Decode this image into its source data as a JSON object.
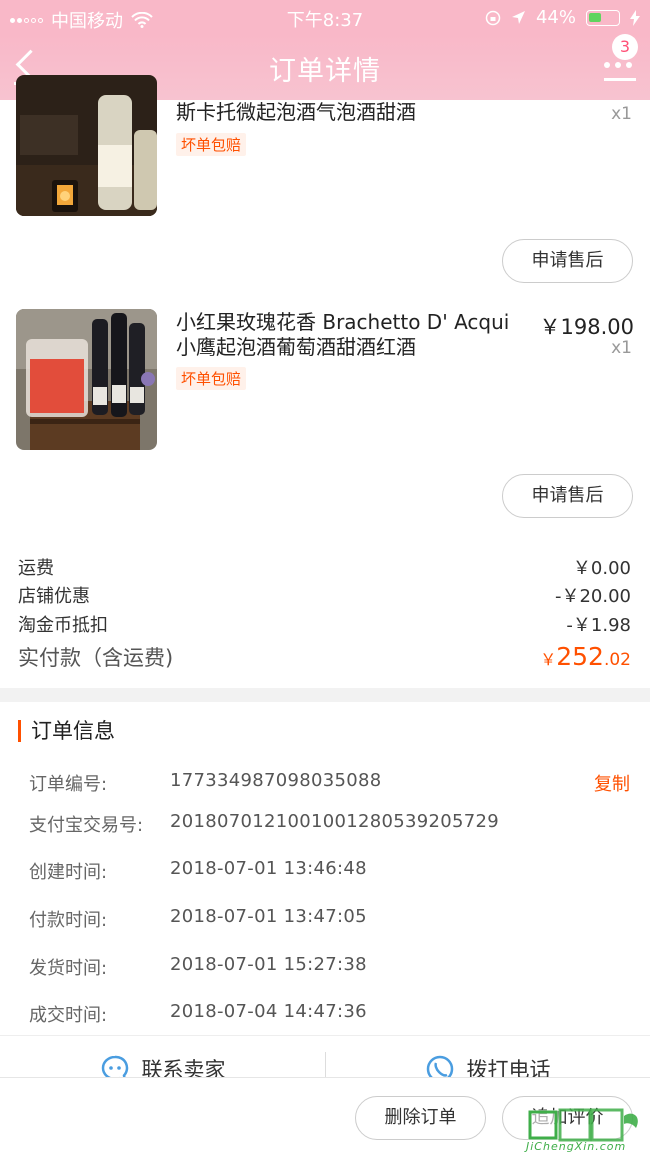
{
  "status_bar": {
    "carrier": "中国移动",
    "time": "下午8:37",
    "battery": "44%"
  },
  "nav": {
    "title": "订单详情",
    "badge": "3"
  },
  "items": [
    {
      "name": "斯卡托微起泡酒气泡酒甜酒",
      "qty": "x1",
      "tag": "坏单包赔",
      "after_sale": "申请售后"
    },
    {
      "name": "小红果玫瑰花香 Brachetto D' Acqui 小鹰起泡酒葡萄酒甜酒红酒",
      "price": "￥198.00",
      "qty": "x1",
      "tag": "坏单包赔",
      "after_sale": "申请售后"
    }
  ],
  "fees": [
    {
      "label": "运费",
      "value": "￥0.00"
    },
    {
      "label": "店铺优惠",
      "value": "-￥20.00"
    },
    {
      "label": "淘金币抵扣",
      "value": "-￥1.98"
    }
  ],
  "total": {
    "label": "实付款（含运费)",
    "currency": "￥",
    "main": "252",
    "decimal": ".02"
  },
  "order_info": {
    "title": "订单信息",
    "copy_label": "复制",
    "rows": [
      {
        "label": "订单编号:",
        "value": "177334987098035088"
      },
      {
        "label": "支付宝交易号:",
        "value": "2018070121001001280539205729"
      },
      {
        "label": "创建时间:",
        "value": "2018-07-01 13:46:48"
      },
      {
        "label": "付款时间:",
        "value": "2018-07-01 13:47:05"
      },
      {
        "label": "发货时间:",
        "value": "2018-07-01 15:27:38"
      },
      {
        "label": "成交时间:",
        "value": "2018-07-04 14:47:36"
      }
    ]
  },
  "contact": {
    "seller": "联系卖家",
    "phone": "拨打电话"
  },
  "actions": {
    "delete": "删除订单",
    "review": "追加评价"
  },
  "watermark": {
    "text": "JiChengXin.com"
  },
  "colors": {
    "accent": "#ff5000",
    "nav_pink": "#f9b8c8"
  }
}
